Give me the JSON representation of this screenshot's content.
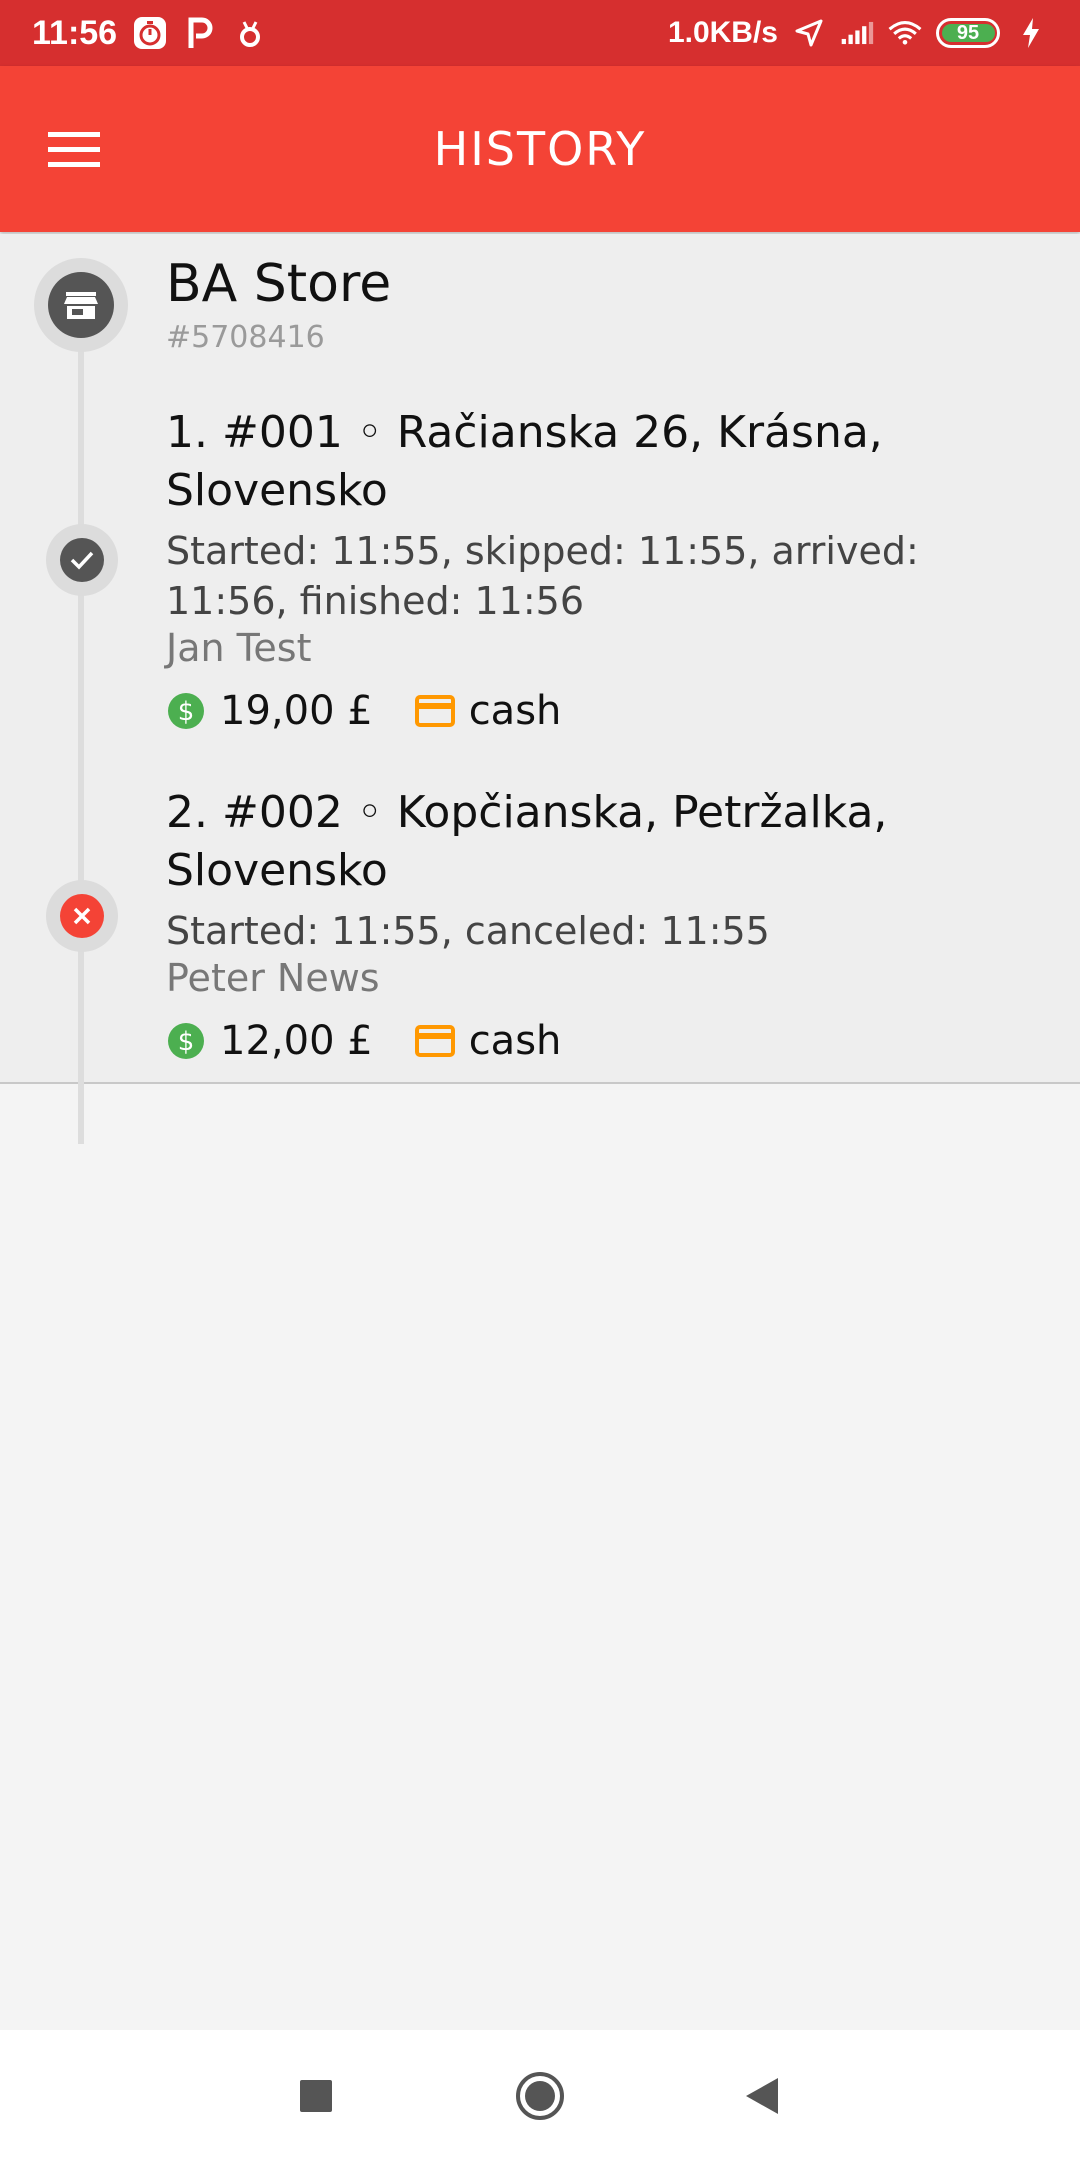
{
  "status_bar": {
    "time": "11:56",
    "network_speed": "1.0KB/s",
    "battery_level": "95",
    "icons": [
      "stopwatch-app-icon",
      "parking-icon",
      "bug-icon",
      "location-arrow-icon",
      "signal-icon",
      "wifi-icon",
      "battery-icon",
      "charging-icon"
    ]
  },
  "app_bar": {
    "title": "HISTORY",
    "menu_icon": "hamburger-menu-icon"
  },
  "store": {
    "name": "BA Store",
    "id": "#5708416",
    "icon": "store-icon"
  },
  "stops": [
    {
      "title": "1. #001 ◦ Račianska 26, Krásna, Slovensko",
      "times": "Started: 11:55, skipped: 11:55, arrived: 11:56, finished: 11:56",
      "person": "Jan Test",
      "amount": "19,00 £",
      "payment": "cash",
      "status": "completed",
      "status_icon": "check-icon"
    },
    {
      "title": "2. #002 ◦ Kopčianska, Petržalka, Slovensko",
      "times": "Started: 11:55, canceled: 11:55",
      "person": "Peter News",
      "amount": "12,00 £",
      "payment": "cash",
      "status": "canceled",
      "status_icon": "close-icon"
    }
  ],
  "colors": {
    "status_bar": "#d62f2f",
    "app_bar": "#f44336",
    "completed": "#555555",
    "canceled": "#f44336",
    "money": "#4caf50",
    "card": "#ff9800"
  },
  "nav_bar": {
    "buttons": [
      "recent-apps-button",
      "home-button",
      "back-button"
    ]
  }
}
